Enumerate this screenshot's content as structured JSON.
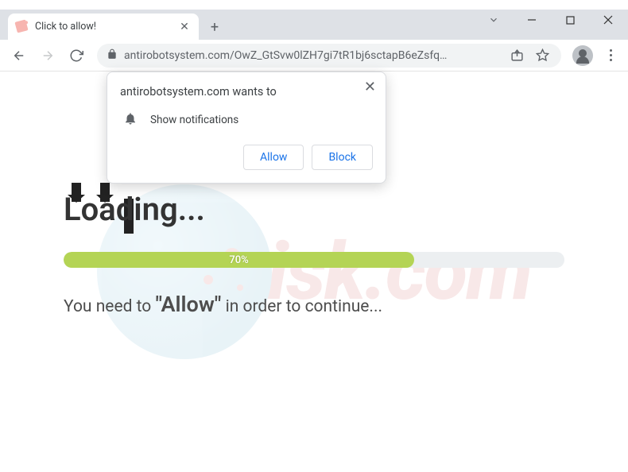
{
  "tab": {
    "title": "Click to allow!",
    "close_glyph": "✕",
    "newtab_glyph": "+"
  },
  "window_controls": {
    "chevron": "⌄",
    "minimize": "—",
    "close": "✕"
  },
  "toolbar": {
    "url_display": "antirobotsystem.com/OwZ_GtSvw0lZH7gi7tR1bj6sctapB6eZsfq…"
  },
  "permission_dialog": {
    "origin_wants_to": "antirobotsystem.com wants to",
    "row_label": "Show notifications",
    "allow_label": "Allow",
    "block_label": "Block",
    "close_glyph": "✕"
  },
  "page": {
    "loading_heading": "Loading...",
    "progress_percent": "70%",
    "progress_value": 70,
    "hint_prefix": "You need to ",
    "hint_emph": "\"Allow\"",
    "hint_suffix": " in order to continue..."
  },
  "watermark": {
    "text": "risk.com"
  }
}
